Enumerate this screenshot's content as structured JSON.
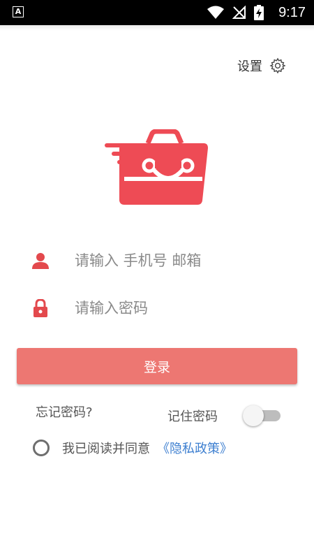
{
  "status_bar": {
    "time": "9:17",
    "left_icon": "A",
    "icons": [
      "wifi-icon",
      "signal-off-icon",
      "battery-charging-icon"
    ]
  },
  "header": {
    "settings_label": "设置",
    "settings_icon": "gear-icon"
  },
  "logo": {
    "icon": "smiling-bag-logo",
    "color": "#ee4b55"
  },
  "form": {
    "username_placeholder": "请输入 手机号 邮箱",
    "username_icon": "user-icon",
    "password_placeholder": "请输入密码",
    "password_icon": "lock-icon",
    "login_label": "登录",
    "forgot_label": "忘记密码?",
    "remember_label": "记住密码",
    "remember_on": false,
    "agree_checked": false,
    "agree_text": "我已阅读并同意",
    "policy_link": "《隐私政策》"
  },
  "colors": {
    "accent": "#ee4b55",
    "button": "#ed7772",
    "link": "#3d7fd0"
  }
}
